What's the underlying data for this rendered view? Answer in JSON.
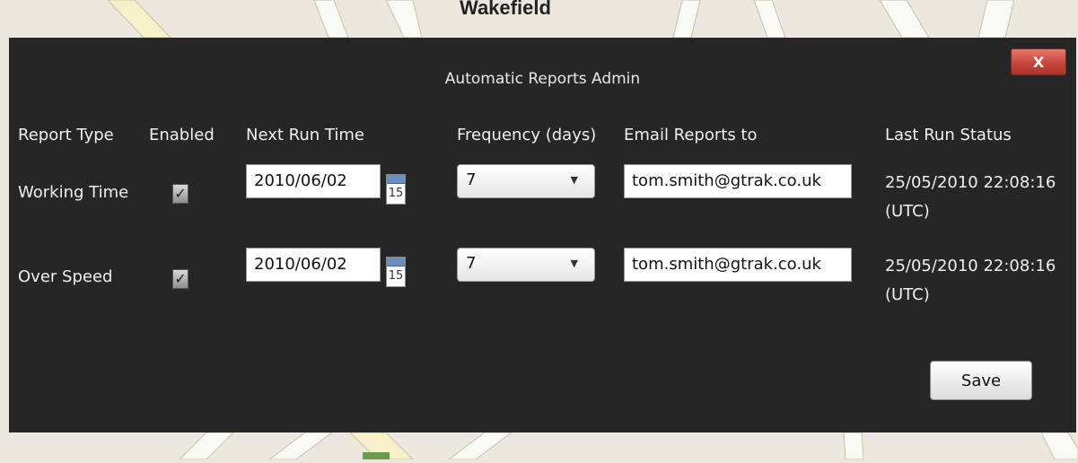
{
  "map": {
    "label": "Wakefield"
  },
  "dialog": {
    "title": "Automatic Reports Admin",
    "close_label": "X",
    "headers": {
      "report_type": "Report Type",
      "enabled": "Enabled",
      "next_run_time": "Next Run Time",
      "frequency": "Frequency (days)",
      "email": "Email Reports to",
      "last_status": "Last Run Status"
    },
    "rows": [
      {
        "report_type": "Working Time",
        "enabled": "✓",
        "next_run_time": "2010/06/02",
        "calendar_day": "15",
        "frequency": "7",
        "email": "tom.smith@gtrak.co.uk",
        "last_status": "25/05/2010 22:08:16 (UTC)"
      },
      {
        "report_type": "Over Speed",
        "enabled": "✓",
        "next_run_time": "2010/06/02",
        "calendar_day": "15",
        "frequency": "7",
        "email": "tom.smith@gtrak.co.uk",
        "last_status": "25/05/2010 22:08:16 (UTC)"
      }
    ],
    "save_label": "Save"
  },
  "colors": {
    "dialog_bg": "#262626",
    "close_button": "#c7463a",
    "map_bg": "#ece8df",
    "map_road": "#f6f1c8"
  }
}
